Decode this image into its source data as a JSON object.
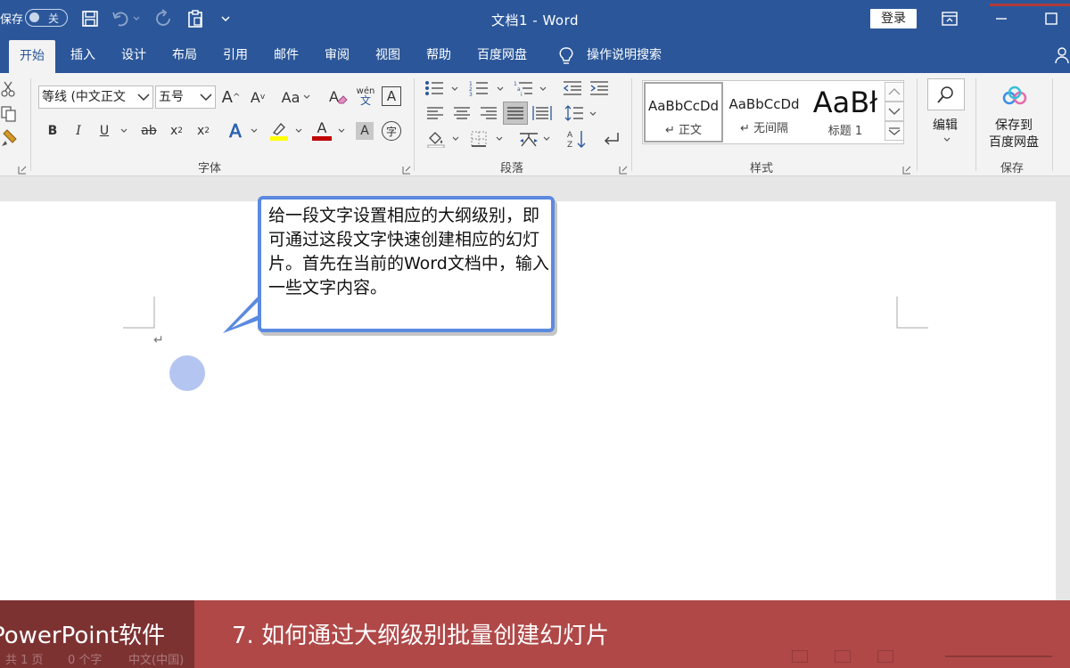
{
  "titlebar": {
    "autosave_label": "保存",
    "autosave_state": "关",
    "title": "文档1  -  Word",
    "login_label": "登录"
  },
  "tabs": [
    {
      "label": "开始",
      "active": true
    },
    {
      "label": "插入"
    },
    {
      "label": "设计"
    },
    {
      "label": "布局"
    },
    {
      "label": "引用"
    },
    {
      "label": "邮件"
    },
    {
      "label": "审阅"
    },
    {
      "label": "视图"
    },
    {
      "label": "帮助"
    },
    {
      "label": "百度网盘"
    }
  ],
  "tell_me": "操作说明搜索",
  "ribbon": {
    "font_name": "等线 (中文正文",
    "font_size": "五号",
    "groups": {
      "font": "字体",
      "paragraph": "段落",
      "styles": "样式",
      "save": "保存"
    },
    "styles": [
      {
        "sample": "AaBbCcDd",
        "name": "↵ 正文"
      },
      {
        "sample": "AaBbCcDd",
        "name": "↵ 无间隔"
      },
      {
        "sample": "AaBł",
        "name": "标题 1"
      }
    ],
    "edit_label": "编辑",
    "save_to_line1": "保存到",
    "save_to_line2": "百度网盘",
    "font_buttons": {
      "bold": "B",
      "italic": "I",
      "underline": "U",
      "strike": "ab",
      "subscript": "x",
      "superscript": "x",
      "case": "Aa",
      "phonetic_top": "wén",
      "phonetic_bottom": "文",
      "char_border": "A",
      "enclose": "字",
      "grow": "A",
      "shrink": "A",
      "effects": "A",
      "font_color": "A",
      "shading": "A"
    }
  },
  "document": {
    "paragraph_mark": "↵"
  },
  "callout": {
    "text": "给一段文字设置相应的大纲级别，即可通过这段文字快速创建相应的幻灯片。首先在当前的Word文档中，输入一些文字内容。"
  },
  "banner": {
    "left": "PowerPoint软件",
    "right": "7. 如何通过大纲级别批量创建幻灯片"
  },
  "statusbar": {
    "pages": "共 1 页",
    "words": "0 个字",
    "language": "中文(中国)"
  },
  "colors": {
    "word_blue": "#2b579a",
    "callout_border": "#5b8ae0",
    "banner_dark": "#7d3232",
    "banner_light": "#b04848"
  }
}
